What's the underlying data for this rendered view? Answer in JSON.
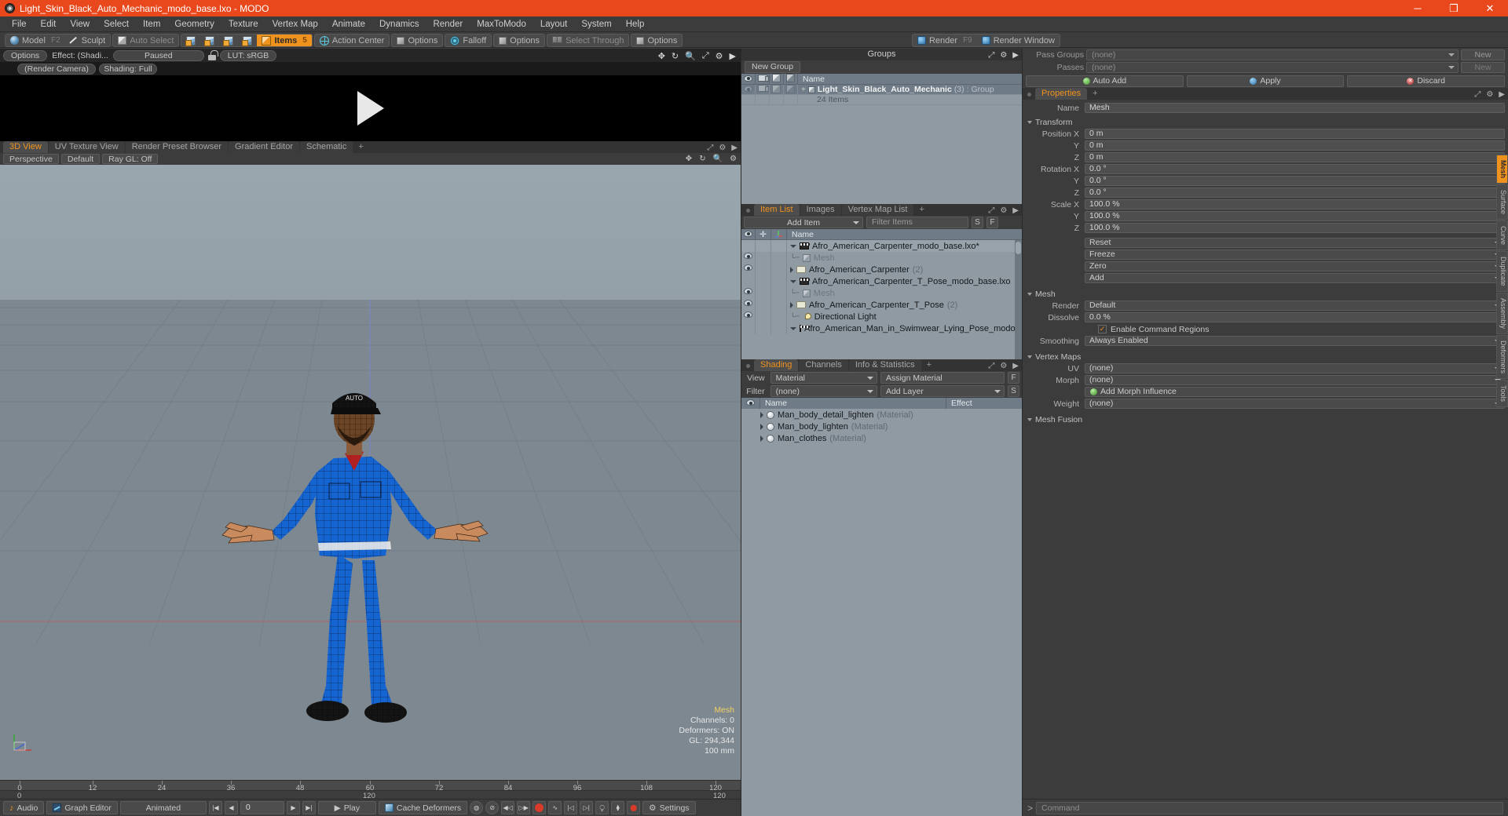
{
  "window": {
    "title": "Light_Skin_Black_Auto_Mechanic_modo_base.lxo - MODO",
    "app_icon": "modo-logo-icon",
    "minimize": "─",
    "maximize": "❐",
    "close": "✕",
    "title_bar_color": "#e8481c"
  },
  "menu": {
    "items": [
      "File",
      "Edit",
      "View",
      "Select",
      "Item",
      "Geometry",
      "Texture",
      "Vertex Map",
      "Animate",
      "Dynamics",
      "Render",
      "MaxToModo",
      "Layout",
      "System",
      "Help"
    ]
  },
  "toolbar": {
    "mode_group": [
      {
        "label": "Model",
        "fkey": "F2",
        "icon": "sphere-icon",
        "active": false
      },
      {
        "label": "Sculpt",
        "fkey": "",
        "icon": "pen-icon",
        "active": false
      }
    ],
    "select_group": [
      {
        "label": "Auto Select",
        "icon": "cube-icon",
        "dim": true
      }
    ],
    "component_icons": [
      "vertex-cube-icon",
      "edge-cube-icon",
      "polygon-cube-icon",
      "material-cube-icon"
    ],
    "items_button": {
      "label": "Items",
      "fkey": "5",
      "icon": "items-cube-icon",
      "active": true
    },
    "action_center": {
      "label": "Action Center",
      "icon": "globe-icon"
    },
    "action_options": {
      "label": "Options",
      "icon": "square-icon"
    },
    "falloff": {
      "label": "Falloff",
      "icon": "falloff-icon"
    },
    "falloff_options": {
      "label": "Options",
      "icon": "square-icon"
    },
    "select_through": {
      "label": "Select Through",
      "icon": "select-through-icon",
      "dim": true
    },
    "select_options": {
      "label": "Options",
      "icon": "square-icon"
    },
    "render": {
      "label": "Render",
      "fkey": "F9",
      "icon": "render-icon"
    },
    "render_window": {
      "label": "Render Window",
      "icon": "render-window-icon"
    }
  },
  "render_preview": {
    "options_label": "Options",
    "effect_label": "Effect: (Shadi...",
    "state_label": "Paused",
    "lock_icon": "unlock-icon",
    "lut_label": "LUT: sRGB",
    "camera_label": "(Render Camera)",
    "shading_label": "Shading: Full",
    "tool_icons": [
      "pan-icon",
      "rotate-icon",
      "zoom-icon",
      "fit-icon",
      "gear-icon",
      "play-arrow-icon"
    ],
    "play_overlay": "play-triangle-icon"
  },
  "viewport": {
    "tabs": [
      {
        "label": "3D View",
        "active": true
      },
      {
        "label": "UV Texture View",
        "active": false
      },
      {
        "label": "Render Preset Browser",
        "active": false
      },
      {
        "label": "Gradient Editor",
        "active": false
      },
      {
        "label": "Schematic",
        "active": false
      },
      {
        "label": "+",
        "active": false
      }
    ],
    "sub_buttons": [
      "Perspective",
      "Default",
      "Ray GL: Off"
    ],
    "tool_icons": [
      "pan-icon",
      "rotate-icon",
      "zoom-icon",
      "gear-icon"
    ],
    "hud": {
      "title": "Mesh",
      "channels": "Channels: 0",
      "deformers": "Deformers: ON",
      "gl": "GL: 294,344",
      "scale": "100 mm"
    },
    "ruler": {
      "ticks": [
        0,
        12,
        24,
        36,
        48,
        60,
        72,
        84,
        96,
        108,
        120
      ],
      "bottom_labels": [
        "0",
        "120",
        "120"
      ]
    }
  },
  "groups_panel": {
    "title": "Groups",
    "new_group_button": "New Group",
    "columns": [
      "eye-icon",
      "camera-icon",
      "cube-outline-icon",
      "cube-shaded-icon",
      "Name"
    ],
    "rows": [
      {
        "indent": 1,
        "expander": "expand-plus-icon",
        "icon": "group-cube-icon",
        "name": "Light_Skin_Black_Auto_Mechanic",
        "count": "(3)",
        "suffix": ": Group",
        "selected": true,
        "sub": "24 Items"
      }
    ],
    "tool_icons": [
      "expand-icon",
      "gear-icon",
      "arrow-icon"
    ]
  },
  "item_list_panel": {
    "tabs": [
      {
        "label": "Item List",
        "active": true
      },
      {
        "label": "Images",
        "active": false
      },
      {
        "label": "Vertex Map List",
        "active": false
      },
      {
        "label": "+",
        "active": false
      }
    ],
    "add_item_button": "Add Item",
    "filter_placeholder": "Filter Items",
    "s_button": "S",
    "f_button": "F",
    "columns": [
      "eye-icon",
      "move-icon",
      "axis-icon",
      "Name"
    ],
    "rows": [
      {
        "indent": 0,
        "tree": "expanded",
        "icon": "clapboard-icon",
        "name": "Afro_American_Carpenter_modo_base.lxo*",
        "count": "",
        "vis": false,
        "dim": false,
        "selected": true
      },
      {
        "indent": 1,
        "tree": "leaf",
        "icon": "cube-icon",
        "name": "Mesh",
        "count": "",
        "vis": true,
        "dim": true,
        "selected": false
      },
      {
        "indent": 1,
        "tree": "collapsed",
        "icon": "folder-icon",
        "name": "Afro_American_Carpenter",
        "count": "(2)",
        "vis": true,
        "dim": false,
        "selected": false
      },
      {
        "indent": 0,
        "tree": "expanded",
        "icon": "clapboard-icon",
        "name": "Afro_American_Carpenter_T_Pose_modo_base.lxo",
        "count": "",
        "vis": false,
        "dim": false,
        "selected": false
      },
      {
        "indent": 1,
        "tree": "leaf",
        "icon": "cube-icon",
        "name": "Mesh",
        "count": "",
        "vis": true,
        "dim": true,
        "selected": false
      },
      {
        "indent": 1,
        "tree": "collapsed",
        "icon": "folder-icon",
        "name": "Afro_American_Carpenter_T_Pose",
        "count": "(2)",
        "vis": true,
        "dim": false,
        "selected": false
      },
      {
        "indent": 1,
        "tree": "leaf",
        "icon": "light-icon",
        "name": "Directional Light",
        "count": "",
        "vis": true,
        "dim": false,
        "selected": false
      },
      {
        "indent": 0,
        "tree": "expanded",
        "icon": "clapboard-icon",
        "name": "Afro_American_Man_in_Swimwear_Lying_Pose_modo_bas …",
        "count": "",
        "vis": false,
        "dim": false,
        "selected": false
      }
    ],
    "tool_icons": [
      "expand-icon",
      "gear-icon",
      "arrow-icon"
    ]
  },
  "shading_panel": {
    "tabs": [
      {
        "label": "Shading",
        "active": true
      },
      {
        "label": "Channels",
        "active": false
      },
      {
        "label": "Info & Statistics",
        "active": false
      },
      {
        "label": "+",
        "active": false
      }
    ],
    "view_label": "View",
    "view_value": "Material",
    "assign_button": "Assign Material",
    "filter_label": "Filter",
    "filter_value": "(none)",
    "add_layer_button": "Add Layer",
    "f_button": "F",
    "s_button": "S",
    "columns": [
      "eye-icon",
      "Name",
      "Effect"
    ],
    "rows": [
      {
        "name": "Man_body_detail_lighten",
        "type": "(Material)",
        "effect": ""
      },
      {
        "name": "Man_body_lighten",
        "type": "(Material)",
        "effect": ""
      },
      {
        "name": "Man_clothes",
        "type": "(Material)",
        "effect": ""
      }
    ],
    "tool_icons": [
      "expand-icon",
      "gear-icon",
      "arrow-icon"
    ]
  },
  "right_panel": {
    "pass_groups_label": "Pass Groups",
    "pass_groups_value": "(none)",
    "pass_groups_new": "New",
    "passes_label": "Passes",
    "passes_value": "(none)",
    "passes_new": "New",
    "auto_add_button": "Auto Add",
    "apply_button": "Apply",
    "discard_button": "Discard",
    "properties_tab": "Properties",
    "properties_plus": "+",
    "tool_icons": [
      "expand-icon",
      "gear-icon",
      "arrow-icon"
    ],
    "name_label": "Name",
    "name_value": "Mesh",
    "sections": {
      "transform": {
        "title": "Transform",
        "rows": [
          {
            "label": "Position X",
            "value": "0 m"
          },
          {
            "label": "Y",
            "value": "0 m"
          },
          {
            "label": "Z",
            "value": "0 m"
          },
          {
            "label": "Rotation X",
            "value": "0.0 °"
          },
          {
            "label": "Y",
            "value": "0.0 °"
          },
          {
            "label": "Z",
            "value": "0.0 °"
          },
          {
            "label": "Scale X",
            "value": "100.0 %"
          },
          {
            "label": "Y",
            "value": "100.0 %"
          },
          {
            "label": "Z",
            "value": "100.0 %"
          }
        ],
        "dropdowns": [
          "Reset",
          "Freeze",
          "Zero",
          "Add"
        ]
      },
      "mesh": {
        "title": "Mesh",
        "render_label": "Render",
        "render_value": "Default",
        "dissolve_label": "Dissolve",
        "dissolve_value": "0.0 %",
        "enable_command_regions": "Enable Command Regions",
        "command_regions_checked": true,
        "smoothing_label": "Smoothing",
        "smoothing_value": "Always Enabled"
      },
      "vertex_maps": {
        "title": "Vertex Maps",
        "uv_label": "UV",
        "uv_value": "(none)",
        "morph_label": "Morph",
        "morph_value": "(none)",
        "add_morph_button": "Add Morph Influence",
        "weight_label": "Weight",
        "weight_value": "(none)"
      },
      "mesh_fusion": {
        "title": "Mesh Fusion"
      }
    },
    "vertical_tabs": [
      {
        "label": "Mesh",
        "active": true
      },
      {
        "label": "Surface",
        "active": false
      },
      {
        "label": "Curve",
        "active": false
      },
      {
        "label": "Duplicate",
        "active": false
      },
      {
        "label": "Assembly",
        "active": false
      },
      {
        "label": "Deformers",
        "active": false
      },
      {
        "label": "Tools",
        "active": false
      }
    ]
  },
  "bottom_bar": {
    "audio_button": "Audio",
    "graph_editor_button": "Graph Editor",
    "animated_dropdown": "Animated",
    "frame_value": "0",
    "play_button": "Play",
    "cache_deformers_button": "Cache Deformers",
    "settings_button": "Settings",
    "nav_icons": [
      "skip-start-icon",
      "step-back-icon",
      "step-forward-icon",
      "skip-end-icon"
    ],
    "transport_icons": [
      "key-icon",
      "no-key-icon",
      "prev-key-icon",
      "next-key-icon",
      "record-icon",
      "curve-icon",
      "start-range-icon",
      "end-range-icon",
      "link-icon",
      "unlink-icon",
      "break-icon"
    ],
    "command_placeholder": "Command",
    "command_prompt": ">"
  }
}
